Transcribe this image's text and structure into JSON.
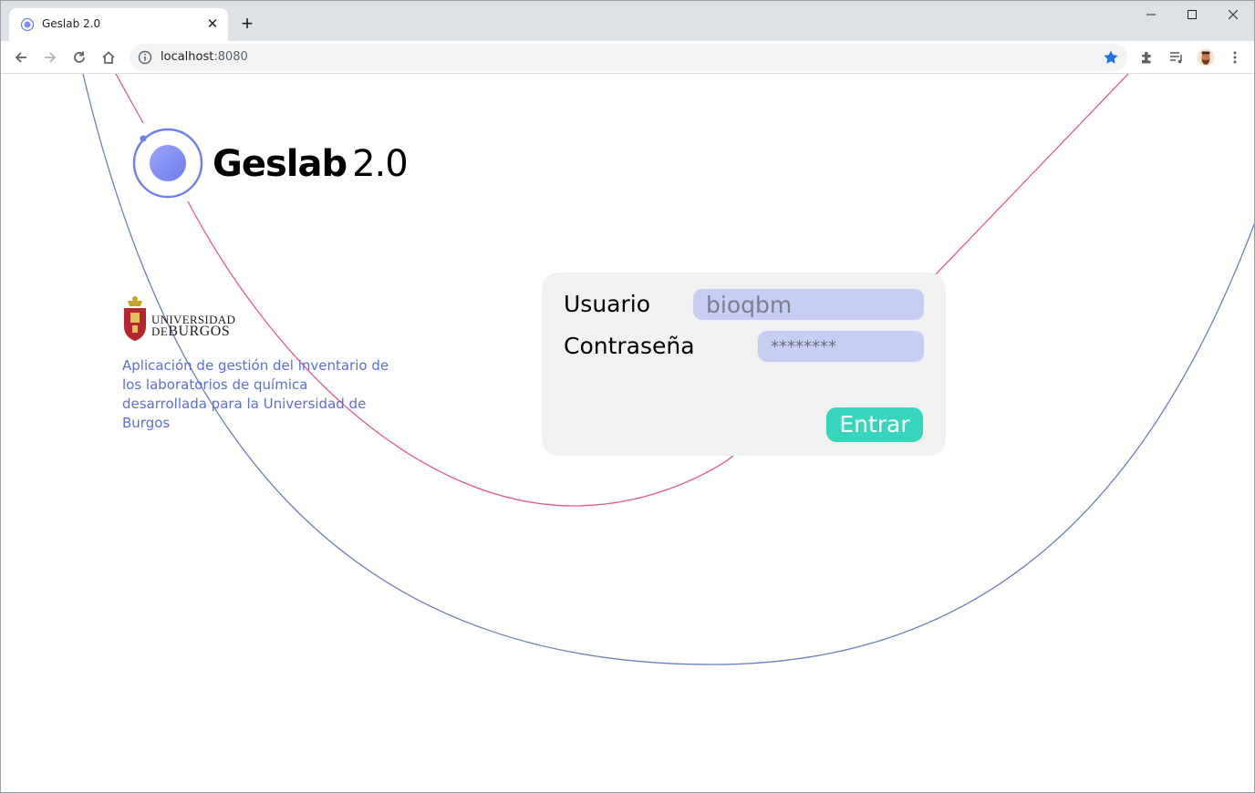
{
  "browser": {
    "tab_title": "Geslab 2.0",
    "tab_close": "✕",
    "new_tab": "+",
    "window_controls": {
      "minimize": "—",
      "maximize": "☐",
      "close": "✕"
    },
    "url_host": "localhost",
    "url_port": ":8080",
    "bookmarked": true,
    "accent": "#1a73e8"
  },
  "app": {
    "title_name": "Geslab",
    "title_version": "2.0",
    "logo_color": "#6f7ef0"
  },
  "institution": {
    "line1": "UNIVERSIDAD",
    "line2_prefix": "DE",
    "line2_main": "BURGOS",
    "description": "Aplicación de gestión del inventario de los laboratorios de química desarrollada para la Universidad de Burgos"
  },
  "login": {
    "user_label": "Usuario",
    "user_value": "bioqbm",
    "password_label": "Contraseña",
    "password_value": "********",
    "submit_label": "Entrar",
    "input_color": "#c6cff3",
    "button_color": "#36d6bd"
  },
  "decoration": {
    "blue_curve_color": "#6b7fc0",
    "pink_curve_color": "#e55a8b"
  }
}
